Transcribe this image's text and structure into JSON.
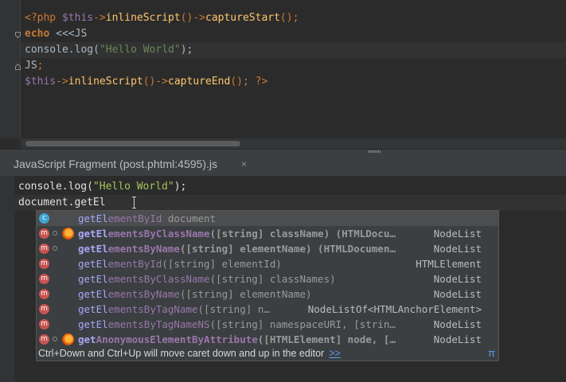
{
  "top_editor": {
    "lines": [
      {
        "open_tag": "<?php",
        "var": "$this",
        "arrow1": "->",
        "fn1": "inlineScript",
        "parens1": "()",
        "arrow2": "->",
        "fn2": "captureStart",
        "tail": "();"
      },
      {
        "kw": "echo",
        "heredoc": " <<<JS"
      },
      {
        "obj": "console",
        "dot": ".",
        "method": "log",
        "open": "(",
        "str": "\"Hello World\"",
        "close": ");"
      },
      {
        "end": "JS",
        "semi": ";"
      },
      {
        "var": "$this",
        "arrow1": "->",
        "fn1": "inlineScript",
        "parens1": "()",
        "arrow2": "->",
        "fn2": "captureEnd",
        "tail": "(); ",
        "close_tag": "?>"
      }
    ]
  },
  "fragment": {
    "title": "JavaScript Fragment (post.phtml:4595).js",
    "close_label": "×",
    "lines": [
      {
        "obj": "console",
        "dot": ".",
        "method": "log",
        "open": "(",
        "str": "\"Hello World\"",
        "close": ");"
      },
      {
        "typed": "document.getEl"
      }
    ]
  },
  "completion": {
    "items": [
      {
        "kind": "c",
        "highlight": "getEl",
        "name": "ementById",
        "params": "",
        "owner": " document",
        "type": "",
        "bold": false,
        "firefox": false,
        "dot": false,
        "selected": true
      },
      {
        "kind": "m",
        "highlight": "getEl",
        "name": "ementsByClassName",
        "params": "([string] className) (HTMLDocu…",
        "type": "NodeList",
        "bold": true,
        "firefox": true,
        "dot": true,
        "selected": false
      },
      {
        "kind": "m",
        "highlight": "getEl",
        "name": "ementsByName",
        "params": "([string] elementName) (HTMLDocumen…",
        "type": "NodeList",
        "bold": true,
        "firefox": false,
        "dot": true,
        "selected": false
      },
      {
        "kind": "m",
        "highlight": "getEl",
        "name": "ementById",
        "params": "([string] elementId)",
        "type": "HTMLElement",
        "bold": false,
        "firefox": false,
        "dot": false,
        "selected": false
      },
      {
        "kind": "m",
        "highlight": "getEl",
        "name": "ementsByClassName",
        "params": "([string] classNames)",
        "type": "NodeList",
        "bold": false,
        "firefox": false,
        "dot": false,
        "selected": false
      },
      {
        "kind": "m",
        "highlight": "getEl",
        "name": "ementsByName",
        "params": "([string] elementName)",
        "type": "NodeList",
        "bold": false,
        "firefox": false,
        "dot": false,
        "selected": false
      },
      {
        "kind": "m",
        "highlight": "getEl",
        "name": "ementsByTagName",
        "params": "([string] n…",
        "type": "NodeListOf<HTMLAnchorElement>",
        "bold": false,
        "firefox": false,
        "dot": false,
        "selected": false
      },
      {
        "kind": "m",
        "highlight": "getEl",
        "name": "ementsByTagNameNS",
        "params": "([string] namespaceURI, [strin…",
        "type": "NodeList",
        "bold": false,
        "firefox": false,
        "dot": false,
        "selected": false
      },
      {
        "kind": "m",
        "highlight": "get",
        "name": "AnonymousElementByAttribute",
        "params": "([HTMLElement] node, […",
        "type": "NodeList",
        "bold": true,
        "firefox": true,
        "dot": true,
        "selected": false
      }
    ],
    "footer": "Ctrl+Down and Ctrl+Up will move caret down and up in the editor",
    "footer_link": ">>",
    "pi": "π"
  },
  "colors": {
    "background": "#2b2b2b",
    "keyword": "#cc7832",
    "string": "#6a8759",
    "variable": "#9876aa",
    "function": "#ffc66d",
    "match": "#a7a7f9",
    "method_icon": "#c75450",
    "class_icon": "#40a5d0",
    "link": "#589df6"
  }
}
